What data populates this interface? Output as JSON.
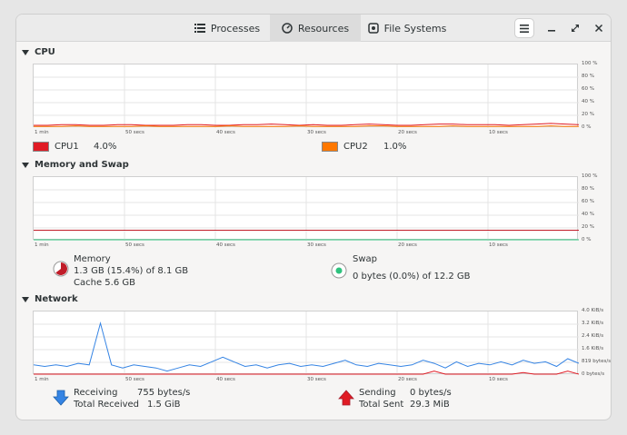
{
  "header": {
    "tabs": [
      {
        "label": "Processes",
        "icon": "list-icon"
      },
      {
        "label": "Resources",
        "icon": "gauge-icon",
        "active": true
      },
      {
        "label": "File Systems",
        "icon": "disk-icon"
      }
    ]
  },
  "cpu": {
    "title": "CPU",
    "y_ticks": [
      "100 %",
      "80 %",
      "60 %",
      "40 %",
      "20 %",
      "0 %"
    ],
    "x_ticks": [
      "1 min",
      "50 secs",
      "40 secs",
      "30 secs",
      "20 secs",
      "10 secs"
    ],
    "cpu1": {
      "label": "CPU1",
      "value": "4.0%",
      "color": "#e01b24"
    },
    "cpu2": {
      "label": "CPU2",
      "value": "1.0%",
      "color": "#ff7800"
    }
  },
  "memory": {
    "title": "Memory and Swap",
    "y_ticks": [
      "100 %",
      "80 %",
      "60 %",
      "40 %",
      "20 %",
      "0 %"
    ],
    "x_ticks": [
      "1 min",
      "50 secs",
      "40 secs",
      "30 secs",
      "20 secs",
      "10 secs"
    ],
    "mem": {
      "label": "Memory",
      "line1": "1.3 GB (15.4%) of 8.1 GB",
      "line2": "Cache 5.6 GB",
      "color": "#c01c28"
    },
    "swap": {
      "label": "Swap",
      "line1": "0 bytes (0.0%) of 12.2 GB",
      "color": "#2ec27e"
    }
  },
  "network": {
    "title": "Network",
    "y_ticks": [
      "4.0 KiB/s",
      "3.2 KiB/s",
      "2.4 KiB/s",
      "1.6 KiB/s",
      "819 bytes/s",
      "0 bytes/s"
    ],
    "x_ticks": [
      "1 min",
      "50 secs",
      "40 secs",
      "30 secs",
      "20 secs",
      "10 secs"
    ],
    "receiving": {
      "label": "Receiving",
      "value": "755 bytes/s",
      "total_label": "Total Received",
      "total": "1.5 GiB",
      "color": "#3584e4"
    },
    "sending": {
      "label": "Sending",
      "value": "0 bytes/s",
      "total_label": "Total Sent",
      "total": "29.3 MiB",
      "color": "#e01b24"
    }
  },
  "chart_data": [
    {
      "type": "line",
      "ylim": [
        0,
        100
      ],
      "series": [
        {
          "name": "CPU1",
          "values": [
            3,
            3,
            4,
            4,
            3,
            3,
            4,
            4,
            3,
            3,
            3,
            4,
            4,
            3,
            3,
            4,
            4,
            5,
            4,
            3,
            4,
            3,
            3,
            4,
            5,
            4,
            3,
            3,
            4,
            5,
            5,
            4,
            4,
            4,
            3,
            4,
            5,
            6,
            5,
            4
          ]
        },
        {
          "name": "CPU2",
          "values": [
            1,
            1,
            1,
            2,
            1,
            1,
            1,
            1,
            2,
            1,
            1,
            1,
            1,
            1,
            2,
            1,
            1,
            1,
            1,
            2,
            1,
            1,
            1,
            1,
            2,
            2,
            1,
            1,
            1,
            1,
            2,
            1,
            1,
            1,
            1,
            1,
            1,
            2,
            1,
            1
          ]
        }
      ]
    },
    {
      "type": "line",
      "ylim": [
        0,
        100
      ],
      "series": [
        {
          "name": "Memory",
          "values": [
            15.4,
            15.4,
            15.4,
            15.4,
            15.4,
            15.4,
            15.4,
            15.4,
            15.4,
            15.4
          ]
        },
        {
          "name": "Swap",
          "values": [
            0,
            0,
            0,
            0,
            0,
            0,
            0,
            0,
            0,
            0
          ]
        }
      ]
    },
    {
      "type": "line",
      "ylim": [
        0,
        4.0
      ],
      "series": [
        {
          "name": "Receiving",
          "values": [
            0.6,
            0.5,
            0.6,
            0.5,
            0.7,
            0.6,
            3.3,
            0.6,
            0.4,
            0.6,
            0.5,
            0.4,
            0.2,
            0.4,
            0.6,
            0.5,
            0.8,
            1.1,
            0.8,
            0.5,
            0.6,
            0.4,
            0.6,
            0.7,
            0.5,
            0.6,
            0.5,
            0.7,
            0.9,
            0.6,
            0.5,
            0.7,
            0.6,
            0.5,
            0.6,
            0.9,
            0.7,
            0.4,
            0.8,
            0.5,
            0.7,
            0.6,
            0.8,
            0.6,
            0.9,
            0.7,
            0.8,
            0.5,
            1.0,
            0.7
          ]
        },
        {
          "name": "Sending",
          "values": [
            0,
            0,
            0,
            0,
            0,
            0,
            0,
            0,
            0,
            0,
            0,
            0,
            0,
            0,
            0,
            0,
            0,
            0,
            0,
            0,
            0,
            0,
            0,
            0,
            0,
            0,
            0,
            0,
            0,
            0,
            0,
            0,
            0,
            0,
            0,
            0,
            0.2,
            0,
            0,
            0,
            0,
            0,
            0,
            0,
            0.1,
            0,
            0,
            0,
            0.2,
            0
          ]
        }
      ]
    }
  ]
}
